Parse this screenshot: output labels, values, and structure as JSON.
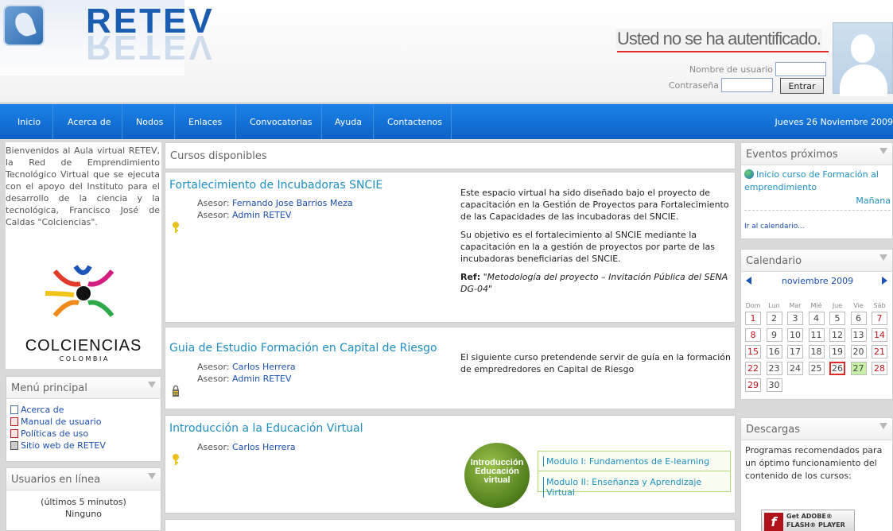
{
  "header": {
    "logo_text": "RETEV",
    "auth_status": "Usted no se ha autentificado.",
    "username_label": "Nombre de usuario",
    "password_label": "Contraseña",
    "login_button": "Entrar"
  },
  "nav": {
    "items": [
      "Inicio",
      "Acerca de",
      "Nodos",
      "Enlaces",
      "Convocatorias",
      "Ayuda",
      "Contactenos"
    ],
    "date": "Jueves 26 Noviembre 2009"
  },
  "intro": {
    "text": "Bienvenidos al Aula virtual RETEV, la Red de Emprendimiento Tecnológico Virtual que se ejecuta con el apoyo del Instituto para el desarrollo de la ciencia y la tecnológica, Francisco José de Caldas \"Colciencias\".",
    "logo_name": "COLCIENCIAS",
    "logo_sub": "C O L O M B I A"
  },
  "main_menu": {
    "title": "Menú principal",
    "items": [
      "Acerca de",
      "Manual de usuario",
      "Políticas de uso",
      "Sitio web de RETEV"
    ]
  },
  "online_users": {
    "title": "Usuarios en línea",
    "period": "(últimos 5 minutos)",
    "value": "Ninguno"
  },
  "courses": {
    "title": "Cursos disponibles",
    "asesor_label": "Asesor:",
    "list": [
      {
        "title": "Fortalecimiento de Incubadoras SNCIE",
        "advisors": [
          "Fernando Jose Barrios Meza",
          "Admin RETEV"
        ],
        "summary_p1": "Este espacio virtual ha sido diseñado bajo el proyecto de capacitación en la Gestión de Proyectos para Fortalecimiento de las Capacidades de las incubadoras del SNCIE.",
        "summary_p2": "Su objetivo es el fortalecimiento al SNCIE mediante la capacitación en la a gestión de proyectos por parte de las incubadoras beneficiarias del SNCIE.",
        "ref_label": "Ref:",
        "ref_text": "\"Metodología del proyecto – Invitación Pública del SENA DG-04\""
      },
      {
        "title": "Guia de Estudio Formación en Capital de Riesgo",
        "advisors": [
          "Carlos Herrera",
          "Admin RETEV"
        ],
        "summary_p1": "El siguiente curso pretendende servir de guía en la formación de empredredores en Capital de Riesgo"
      },
      {
        "title": "Introducción a la Educación Virtual",
        "advisors": [
          "Carlos Herrera"
        ],
        "badge_line1": "Introducción",
        "badge_line2": "Educación",
        "badge_line3": "virtual",
        "modules": [
          "Modulo I: Fundamentos de E-learning",
          "Modulo II: Enseñanza y Aprendizaje Virtual"
        ]
      }
    ]
  },
  "events": {
    "title": "Eventos próximos",
    "event_name": "Inicio curso de Formación al emprendimiento",
    "event_when": "Mañana",
    "calendar_link": "Ir al calendario..."
  },
  "calendar": {
    "title": "Calendario",
    "month": "noviembre 2009",
    "weekdays": [
      "Dom",
      "Lun",
      "Mar",
      "Mié",
      "Jue",
      "Vie",
      "Sáb"
    ],
    "days": [
      "1",
      "2",
      "3",
      "4",
      "5",
      "6",
      "7",
      "8",
      "9",
      "10",
      "11",
      "12",
      "13",
      "14",
      "15",
      "16",
      "17",
      "18",
      "19",
      "20",
      "21",
      "22",
      "23",
      "24",
      "25",
      "26",
      "27",
      "28",
      "29",
      "30"
    ],
    "today": "26",
    "event_day": "27"
  },
  "downloads": {
    "title": "Descargas",
    "text": "Programas recomendados para un óptimo funcionamiento del contenido de los cursos:",
    "badge_line1": "Get ADOBE®",
    "badge_line2": "FLASH® PLAYER"
  }
}
